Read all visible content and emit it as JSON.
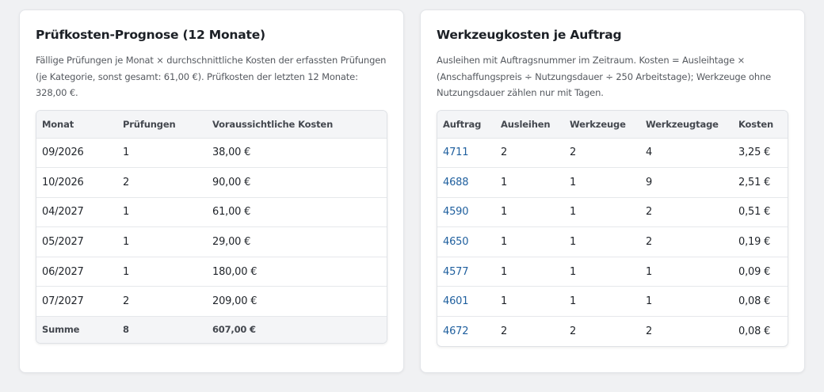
{
  "forecast": {
    "title": "Prüfkosten-Prognose (12 Monate)",
    "description": "Fällige Prüfungen je Monat × durchschnittliche Kosten der erfassten Prüfungen (je Kategorie, sonst gesamt: 61,00 €). Prüfkosten der letzten 12 Monate: 328,00 €.",
    "columns": [
      "Monat",
      "Prüfungen",
      "Voraussichtliche Kosten"
    ],
    "rows": [
      {
        "month": "09/2026",
        "inspections": "1",
        "cost": "38,00 €"
      },
      {
        "month": "10/2026",
        "inspections": "2",
        "cost": "90,00 €"
      },
      {
        "month": "04/2027",
        "inspections": "1",
        "cost": "61,00 €"
      },
      {
        "month": "05/2027",
        "inspections": "1",
        "cost": "29,00 €"
      },
      {
        "month": "06/2027",
        "inspections": "1",
        "cost": "180,00 €"
      },
      {
        "month": "07/2027",
        "inspections": "2",
        "cost": "209,00 €"
      }
    ],
    "sum": {
      "label": "Summe",
      "inspections": "8",
      "cost": "607,00 €"
    }
  },
  "tools": {
    "title": "Werkzeugkosten je Auftrag",
    "description": "Ausleihen mit Auftragsnummer im Zeitraum. Kosten = Ausleihtage × (Anschaffungspreis ÷ Nutzungsdauer ÷ 250 Arbeitstage); Werkzeuge ohne Nutzungsdauer zählen nur mit Tagen.",
    "columns": [
      "Auftrag",
      "Ausleihen",
      "Werkzeuge",
      "Werkzeugtage",
      "Kosten"
    ],
    "rows": [
      {
        "order": "4711",
        "loans": "2",
        "tools": "2",
        "tool_days": "4",
        "cost": "3,25 €"
      },
      {
        "order": "4688",
        "loans": "1",
        "tools": "1",
        "tool_days": "9",
        "cost": "2,51 €"
      },
      {
        "order": "4590",
        "loans": "1",
        "tools": "1",
        "tool_days": "2",
        "cost": "0,51 €"
      },
      {
        "order": "4650",
        "loans": "1",
        "tools": "1",
        "tool_days": "2",
        "cost": "0,19 €"
      },
      {
        "order": "4577",
        "loans": "1",
        "tools": "1",
        "tool_days": "1",
        "cost": "0,09 €"
      },
      {
        "order": "4601",
        "loans": "1",
        "tools": "1",
        "tool_days": "1",
        "cost": "0,08 €"
      },
      {
        "order": "4672",
        "loans": "2",
        "tools": "2",
        "tool_days": "2",
        "cost": "0,08 €"
      }
    ]
  },
  "colors": {
    "page_bg": "#f0f1f3",
    "card_bg": "#ffffff",
    "link": "#1f5f9e",
    "header_bg": "#f4f5f7"
  }
}
